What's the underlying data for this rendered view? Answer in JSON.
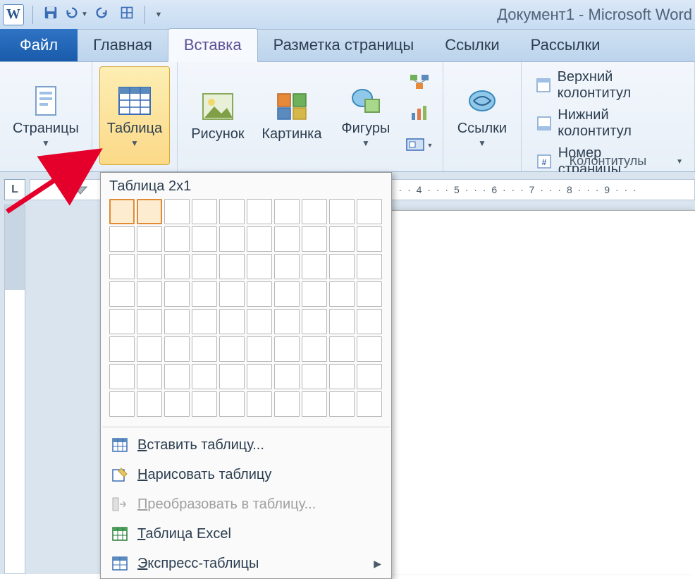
{
  "title": "Документ1  -  Microsoft Word",
  "tabs": {
    "file": "Файл",
    "home": "Главная",
    "insert": "Вставка",
    "layout": "Разметка страницы",
    "references": "Ссылки",
    "mailings": "Рассылки"
  },
  "ribbon": {
    "pages": "Страницы",
    "table": "Таблица",
    "picture": "Рисунок",
    "clipart": "Картинка",
    "shapes": "Фигуры",
    "links": "Ссылки",
    "header": "Верхний колонтитул",
    "footer": "Нижний колонтитул",
    "pagenum": "Номер страницы",
    "hf_group": "Колонтитулы"
  },
  "dropdown": {
    "title": "Таблица 2x1",
    "grid_cols": 10,
    "grid_rows": 8,
    "selected_cols": 2,
    "selected_rows": 1,
    "insert": "Вставить таблицу...",
    "draw": "Нарисовать таблицу",
    "convert": "Преобразовать в таблицу...",
    "excel": "Таблица Excel",
    "quick": "Экспресс-таблицы"
  },
  "ruler_h": "· · · 4 · · · 5 · · · 6 · · · 7 · · · 8 · · · 9 · · ·",
  "corner": "L"
}
